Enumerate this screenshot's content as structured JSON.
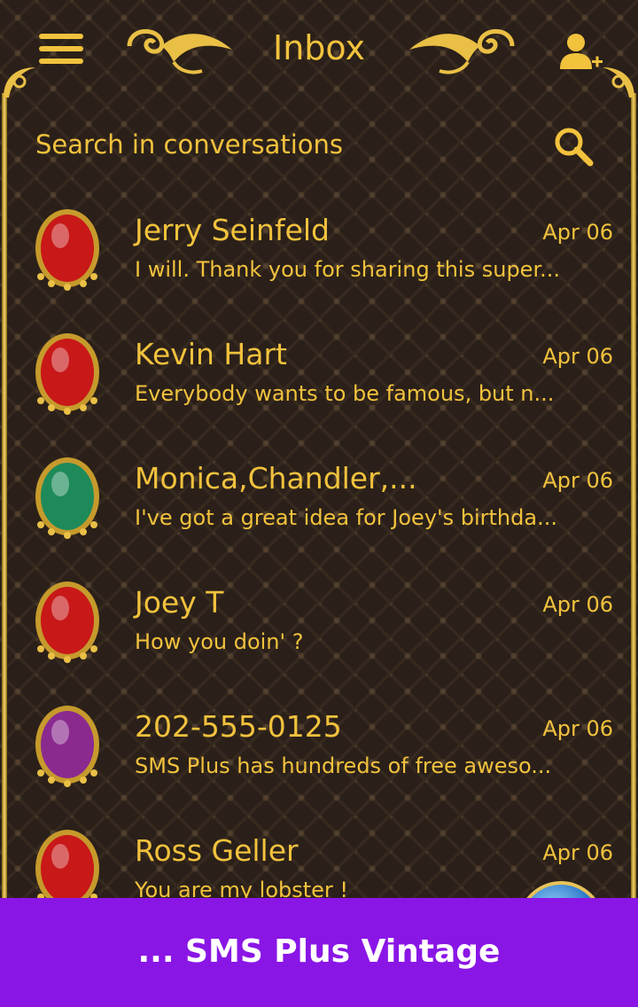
{
  "header": {
    "title": "Inbox"
  },
  "search": {
    "placeholder": "Search in conversations"
  },
  "conversations": [
    {
      "name": "Jerry Seinfeld",
      "date": "Apr 06",
      "preview": "I will. Thank you for sharing this super...",
      "gem_color": "#c81818"
    },
    {
      "name": "Kevin Hart",
      "date": "Apr 06",
      "preview": "Everybody wants to be famous, but n...",
      "gem_color": "#c81818"
    },
    {
      "name": "Monica,Chandler,...",
      "date": "Apr 06",
      "preview": "I've got a great idea for Joey's birthda...",
      "gem_color": "#1e8a5a"
    },
    {
      "name": "Joey T",
      "date": "Apr 06",
      "preview": "How you doin' ?",
      "gem_color": "#c81818"
    },
    {
      "name": "202-555-0125",
      "date": "Apr 06",
      "preview": "SMS Plus has hundreds of free aweso...",
      "gem_color": "#8a2a8f"
    },
    {
      "name": "Ross Geller",
      "date": "Apr 06",
      "preview": "You are my lobster !",
      "gem_color": "#c81818"
    }
  ],
  "banner": {
    "text": "... SMS Plus Vintage"
  },
  "colors": {
    "gold": "#f2c23d",
    "banner": "#8a16e6"
  },
  "icons": {
    "menu": "hamburger-icon",
    "add_contact": "add-contact-icon",
    "search": "search-icon",
    "fab": "new-message-icon"
  }
}
